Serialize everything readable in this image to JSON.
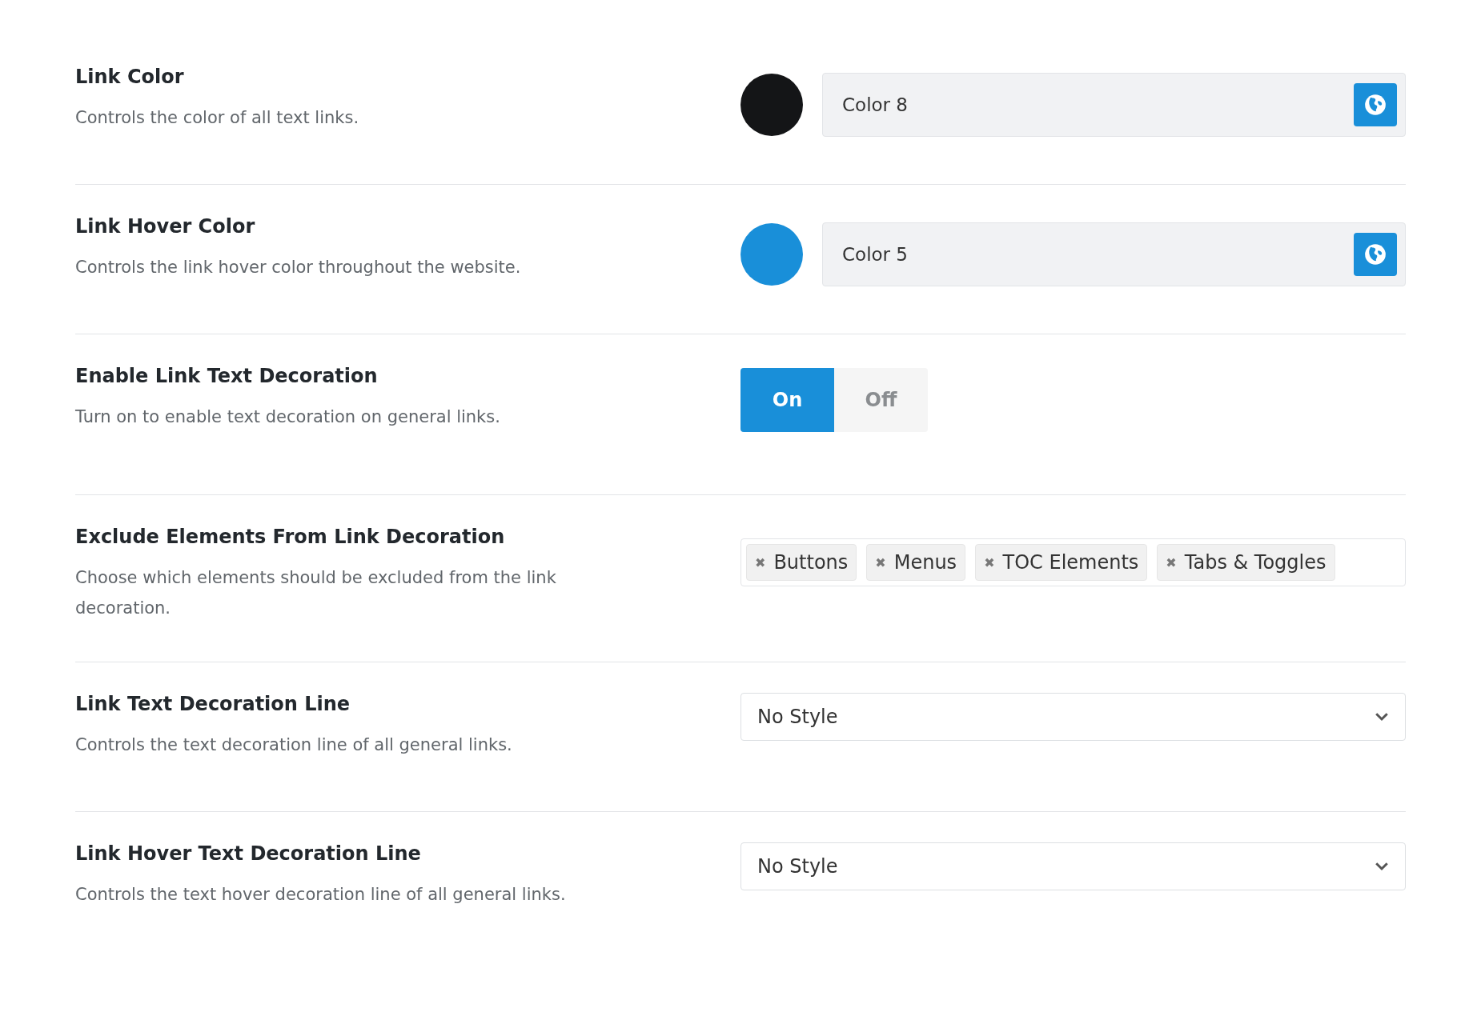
{
  "settings": [
    {
      "kind": "color",
      "title": "Link Color",
      "description": "Controls the color of all text links.",
      "color": "#141517",
      "value": "Color 8"
    },
    {
      "kind": "color",
      "title": "Link Hover Color",
      "description": "Controls the link hover color throughout the website.",
      "color": "#198fd9",
      "value": "Color 5"
    },
    {
      "kind": "toggle",
      "title": "Enable Link Text Decoration",
      "description": "Turn on to enable text decoration on general links.",
      "options": [
        {
          "label": "On",
          "selected": true
        },
        {
          "label": "Off",
          "selected": false
        }
      ]
    },
    {
      "kind": "tags",
      "title": "Exclude Elements From Link Decoration",
      "description": "Choose which elements should be excluded from the link decoration.",
      "tags": [
        {
          "remove": "✖",
          "label": "Buttons"
        },
        {
          "remove": "✖",
          "label": "Menus"
        },
        {
          "remove": "✖",
          "label": "TOC Elements"
        },
        {
          "remove": "✖",
          "label": "Tabs & Toggles"
        }
      ]
    },
    {
      "kind": "select",
      "title": "Link Text Decoration Line",
      "description": "Controls the text decoration line of all general links.",
      "value": "No Style"
    },
    {
      "kind": "select",
      "title": "Link Hover Text Decoration Line",
      "description": "Controls the text hover decoration line of all general links.",
      "value": "No Style"
    }
  ]
}
